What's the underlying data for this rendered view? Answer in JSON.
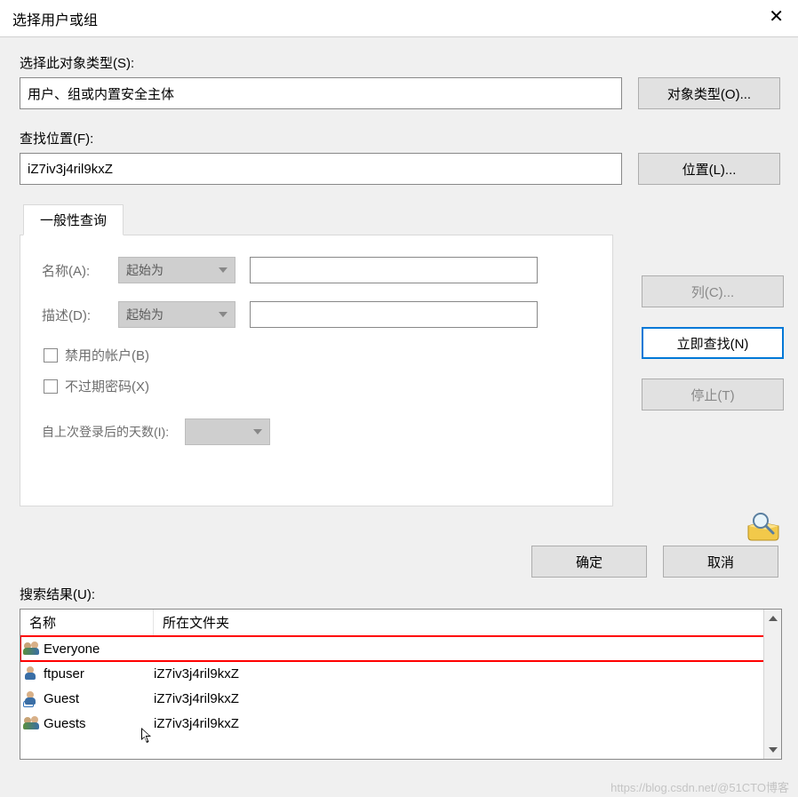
{
  "window": {
    "title": "选择用户或组"
  },
  "labels": {
    "object_type": "选择此对象类型(S):",
    "location": "查找位置(F):",
    "results": "搜索结果(U):"
  },
  "fields": {
    "object_type_value": "用户、组或内置安全主体",
    "location_value": "iZ7iv3j4ril9kxZ"
  },
  "buttons": {
    "object_types": "对象类型(O)...",
    "locations": "位置(L)...",
    "columns": "列(C)...",
    "find_now": "立即查找(N)",
    "stop": "停止(T)",
    "ok": "确定",
    "cancel": "取消"
  },
  "tabs": {
    "general": "一般性查询"
  },
  "query": {
    "name_label": "名称(A):",
    "desc_label": "描述(D):",
    "starts_with": "起始为",
    "disabled_accounts": "禁用的帐户(B)",
    "non_expiring": "不过期密码(X)",
    "days_label": "自上次登录后的天数(I):"
  },
  "grid": {
    "col_name": "名称",
    "col_folder": "所在文件夹",
    "rows": [
      {
        "icon": "group",
        "name": "Everyone",
        "folder": "",
        "highlight": true
      },
      {
        "icon": "user",
        "name": "ftpuser",
        "folder": "iZ7iv3j4ril9kxZ"
      },
      {
        "icon": "guest",
        "name": "Guest",
        "folder": "iZ7iv3j4ril9kxZ"
      },
      {
        "icon": "group",
        "name": "Guests",
        "folder": "iZ7iv3j4ril9kxZ"
      }
    ]
  },
  "watermark": "https://blog.csdn.net/@51CTO博客"
}
